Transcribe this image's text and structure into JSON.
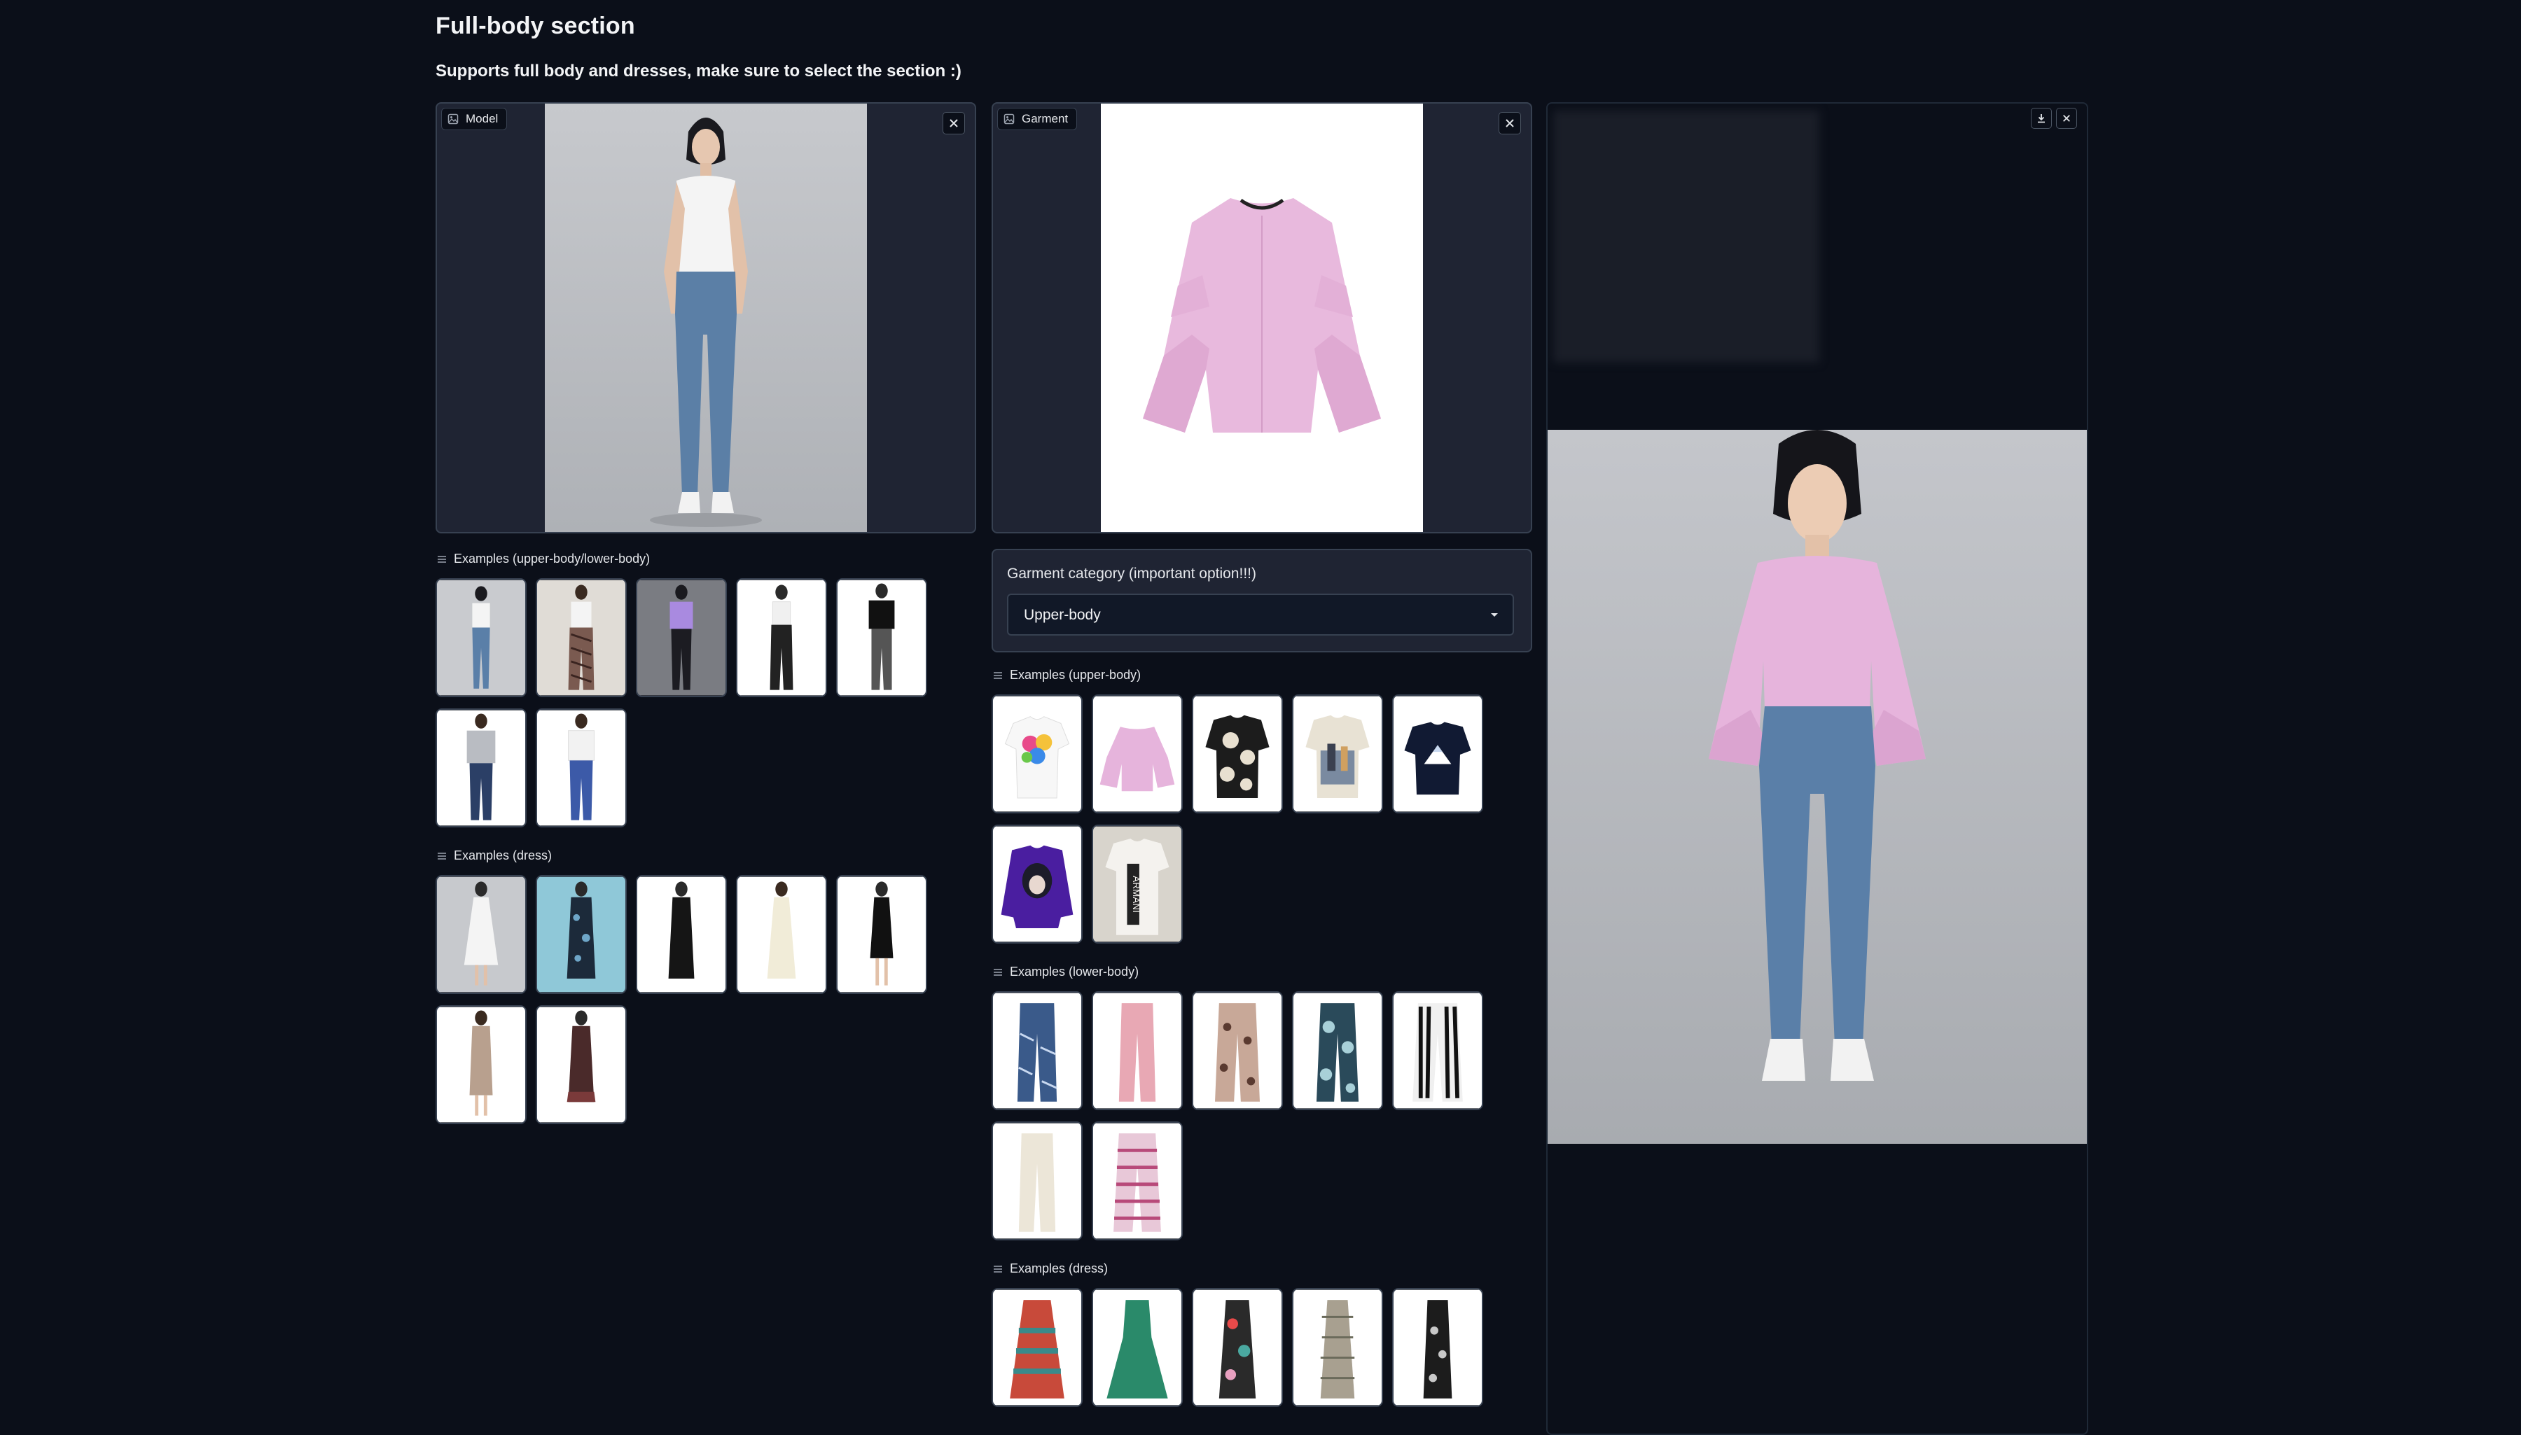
{
  "page": {
    "title": "Full-body section",
    "subtitle": "Supports full body and dresses, make sure to select the section :)"
  },
  "model_panel": {
    "label": "Model",
    "icon": "image-icon"
  },
  "garment_panel": {
    "label": "Garment",
    "icon": "image-icon"
  },
  "category": {
    "label": "Garment category (important option!!!)",
    "value": "Upper-body"
  },
  "examples": {
    "model_upper_lower": {
      "label": "Examples (upper-body/lower-body)"
    },
    "model_dress": {
      "label": "Examples (dress)"
    },
    "garment_upper": {
      "label": "Examples (upper-body)"
    },
    "garment_lower": {
      "label": "Examples (lower-body)"
    },
    "garment_dress": {
      "label": "Examples (dress)"
    }
  },
  "colors": {
    "background": "#0b0f19",
    "panel": "#1f2433",
    "border": "#374151",
    "text": "#f3f4f6"
  }
}
